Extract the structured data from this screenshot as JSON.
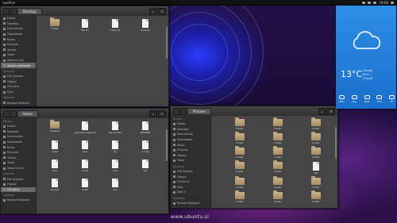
{
  "topbar": {
    "app_name": "nautilus",
    "clock": "19:00"
  },
  "window1": {
    "path": "Desktop",
    "sidebar": {
      "sections": [
        {
          "title": "",
          "items": [
            "Home",
            "Desktop",
            "Documents",
            "Downloads",
            "Music",
            "Pictures",
            "Videos",
            "Trash",
            "Ubuntu One",
            "Ubuntu Software"
          ]
        },
        {
          "title": "Devices",
          "items": [
            "File System",
            "Floppy",
            "CD Drive",
            "Disk"
          ]
        },
        {
          "title": "Network",
          "items": [
            "Browse Network"
          ]
        }
      ],
      "selected": "Ubuntu Software"
    },
    "files": [
      {
        "type": "folder",
        "name": "Folder"
      },
      {
        "type": "doc",
        "name": "file.txt"
      },
      {
        "type": "doc",
        "name": "notes.txt"
      },
      {
        "type": "doc",
        "name": "readme"
      }
    ]
  },
  "window2": {
    "path": "Home",
    "sidebar": {
      "sections": [
        {
          "title": "Places",
          "items": [
            "Home",
            "Desktop",
            "Documents",
            "Downloads",
            "Music",
            "Pictures",
            "Videos",
            "Trash",
            "Ubuntu One"
          ]
        },
        {
          "title": "Devices",
          "items": [
            "File System",
            "Floppy",
            "CD Drive"
          ]
        },
        {
          "title": "Network",
          "items": [
            "Browse Network"
          ]
        }
      ],
      "selected": "CD Drive"
    },
    "files": [
      {
        "type": "folder",
        "name": "Desktop"
      },
      {
        "type": "doc",
        "name": "examples.desktop"
      },
      {
        "type": "doc",
        "name": "file.sample"
      },
      {
        "type": "doc",
        "name": "README"
      },
      {
        "type": "doc",
        "name": "notes"
      },
      {
        "type": "doc",
        "name": "text"
      },
      {
        "type": "doc",
        "name": "log"
      },
      {
        "type": "doc",
        "name": "config"
      },
      {
        "type": "doc",
        "name": "data"
      },
      {
        "type": "doc",
        "name": "script"
      },
      {
        "type": "doc",
        "name": "todo"
      },
      {
        "type": "doc",
        "name": "list"
      },
      {
        "type": "doc",
        "name": "backup"
      },
      {
        "type": "doc",
        "name": "draft"
      },
      {
        "type": "doc",
        "name": "misc"
      }
    ]
  },
  "window3": {
    "path": "Pictures",
    "sidebar": {
      "sections": [
        {
          "title": "Places",
          "items": [
            "Home",
            "Desktop",
            "Documents",
            "Downloads",
            "Music",
            "Pictures",
            "Videos",
            "Trash"
          ]
        },
        {
          "title": "Devices",
          "items": [
            "File System",
            "Floppy",
            "CD Drive",
            "Disk",
            "Disk 2"
          ]
        },
        {
          "title": "Network",
          "items": [
            "Browse Network"
          ]
        }
      ],
      "selected": ""
    },
    "files": [
      {
        "type": "folder",
        "name": "Folder"
      },
      {
        "type": "folder",
        "name": "Folder"
      },
      {
        "type": "folder",
        "name": "Folder"
      },
      {
        "type": "folder",
        "name": "Folder"
      },
      {
        "type": "folder",
        "name": "Folder"
      },
      {
        "type": "folder",
        "name": "Folder"
      },
      {
        "type": "folder",
        "name": "Folder"
      },
      {
        "type": "folder",
        "name": "Folder"
      },
      {
        "type": "folder",
        "name": "Folder"
      },
      {
        "type": "folder",
        "name": "Folder"
      },
      {
        "type": "folder",
        "name": "Folder"
      },
      {
        "type": "doc",
        "name": "file"
      },
      {
        "type": "folder",
        "name": "Folder"
      },
      {
        "type": "folder",
        "name": "Folder"
      },
      {
        "type": "folder",
        "name": "Folder"
      },
      {
        "type": "folder",
        "name": "Folder"
      },
      {
        "type": "folder",
        "name": "Folder"
      },
      {
        "type": "folder",
        "name": "Folder"
      }
    ]
  },
  "weather": {
    "temp": "13°C",
    "condition": "Cloudy",
    "humidity": "65%",
    "wind": "4 km/h",
    "forecast": [
      {
        "day": "Mon"
      },
      {
        "day": "Tue"
      },
      {
        "day": "Wed"
      },
      {
        "day": "Thu"
      },
      {
        "day": "Fri"
      }
    ]
  },
  "watermark": "www.ubuntu.si"
}
